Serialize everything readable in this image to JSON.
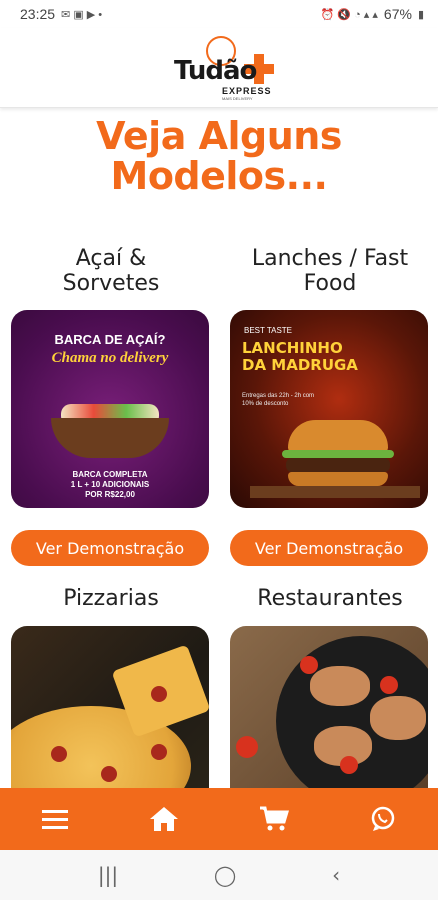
{
  "status_bar": {
    "time": "23:25",
    "battery": "67%"
  },
  "header": {
    "logo_text": "Tudão",
    "logo_sub": "EXPRESS",
    "logo_tag": "MAIS DELIVERY"
  },
  "hero": {
    "title_line1": "Veja Alguns",
    "title_line2": "Modelos..."
  },
  "cards": [
    {
      "title_line1": "Açaí &",
      "title_line2": "Sorvetes",
      "button": "Ver Demonstração",
      "image": {
        "line1": "BARCA DE AÇAÍ?",
        "line2": "Chama no delivery",
        "line3": "BARCA COMPLETA",
        "line4": "1 L + 10 ADICIONAIS",
        "line5": "POR R$22,00"
      }
    },
    {
      "title_line1": "Lanches / Fast",
      "title_line2": "Food",
      "button": "Ver Demonstração",
      "image": {
        "tag": "BEST TASTE",
        "line1": "LANCHINHO",
        "line2": "DA MADRUGA",
        "line3": "Entregas das 22h - 2h com",
        "line4": "10% de desconto"
      }
    },
    {
      "title_line1": "Pizzarias",
      "title_line2": ""
    },
    {
      "title_line1": "Restaurantes",
      "title_line2": ""
    }
  ],
  "bottom_nav": {
    "items": [
      "menu-icon",
      "home-icon",
      "cart-icon",
      "whatsapp-icon"
    ]
  },
  "android_nav": {
    "items": [
      "recents-icon",
      "home-circle-icon",
      "back-icon"
    ]
  },
  "colors": {
    "accent": "#f26a1b"
  }
}
